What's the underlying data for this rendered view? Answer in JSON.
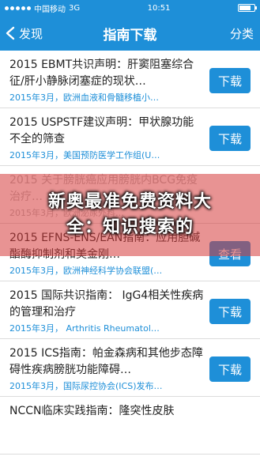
{
  "status": {
    "carrier": "中国移动",
    "network": "3G",
    "time": "10:51"
  },
  "nav": {
    "back_label": "发现",
    "title": "指南下载",
    "category_label": "分类"
  },
  "items": [
    {
      "title": "2015 EBMT共识声明：肝窦阻塞综合征/肝小静脉闭塞症的现状…",
      "meta": "2015年3月，欧洲血液和骨髓移植小…",
      "button": "下载"
    },
    {
      "title": "2015 USPSTF建议声明：甲状腺功能不全的筛查",
      "meta": "2015年3月，美国预防医学工作组(U…",
      "button": "下载"
    },
    {
      "title": "2015 关于膀胱癌应用膀胱内BCG免疫治疗…",
      "meta": "2015年3月，欧洲泌尿外科…",
      "button": ""
    },
    {
      "title": "2015 EFNS-ENS/EAN指南：应用胆碱酯酶抑制剂和美金刚…",
      "meta": "2015年3月，欧洲神经科学协会联盟(…",
      "button": "查看"
    },
    {
      "title": "2015 国际共识指南： IgG4相关性疾病的管理和治疗",
      "meta": "2015年3月， Arthritis Rheumatol…",
      "button": "下载"
    },
    {
      "title": "2015 ICS指南：帕金森病和其他步态障碍性疾病膀胱功能障碍…",
      "meta": "2015年3月，国际尿控协会(ICS)发布…",
      "button": "下载"
    },
    {
      "title": "NCCN临床实践指南：隆突性皮肤",
      "meta": "",
      "button": ""
    }
  ],
  "overlay": {
    "text": "新奥最准免费资料大全：知识搜索的"
  },
  "colors": {
    "primary": "#1e8fd8",
    "overlay": "#d63b3b"
  }
}
